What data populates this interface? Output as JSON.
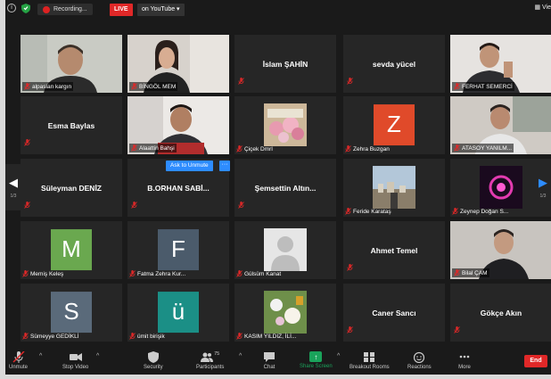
{
  "topbar": {
    "info_glyph": "i",
    "recording_label": "Recording...",
    "live_label": "LIVE",
    "youtube_label": "on YouTube ▾",
    "view_label": "▦ Vie"
  },
  "controls": {
    "ask_to_unmute": "Ask to Unmute",
    "more": "···"
  },
  "nav": {
    "prev_arrow": "◀",
    "next_arrow": "▶",
    "left_page": "1/3",
    "right_page": "1/3"
  },
  "tiles": [
    {
      "label": "alpaslan kargın"
    },
    {
      "label": "BİNGÖL MEM"
    },
    {
      "name": "İslam ŞAHİN"
    },
    {
      "name": "sevda yücel"
    },
    {
      "label": "FERHAT SEMERCİ"
    },
    {
      "name": "Esma Baylas"
    },
    {
      "label": "Alaattin Bahşi"
    },
    {
      "label": "Çiçek Dmrl"
    },
    {
      "label": "Zehra Buzgan",
      "initial": "Z"
    },
    {
      "label": "ATASOY YANILM..."
    },
    {
      "name": "Süleyman DENİZ"
    },
    {
      "name": "B.ORHAN SABİ..."
    },
    {
      "name": "Şemsettin Altın..."
    },
    {
      "label": "Feride Karataş"
    },
    {
      "label": "Zeynep Doğan S..."
    },
    {
      "label": "Memiş Keleş",
      "initial": "M"
    },
    {
      "label": "Fatma Zehra Kur...",
      "initial": "F"
    },
    {
      "label": "Gülsüm Kanat"
    },
    {
      "name": "Ahmet Temel"
    },
    {
      "label": "Bilal ÇAM"
    },
    {
      "label": "Sümeyye GEDİKLİ",
      "initial": "S"
    },
    {
      "label": "ümit birişik",
      "initial": "ü"
    },
    {
      "label": "KASIM YILDIZ, İLİ..."
    },
    {
      "name": "Caner Sancı"
    },
    {
      "name": "Gökçe Akın"
    }
  ],
  "toolbar": {
    "unmute": "Unmute",
    "stop_video": "Stop Video",
    "security": "Security",
    "participants": "Participants",
    "participants_count": "75",
    "chat": "Chat",
    "share_screen": "Share Screen",
    "breakout_rooms": "Breakout Rooms",
    "reactions": "Reactions",
    "more": "More",
    "end": "End",
    "caret": "^"
  },
  "colors": {
    "live": "#e02828",
    "active_speaker_border": "#c9d53a",
    "share_screen": "#1aa35b",
    "accent_blue": "#2d8cff",
    "avatar_M": "#6aa84f",
    "avatar_F": "#4b5b6b",
    "avatar_S": "#5a6a7a",
    "avatar_u": "#1b8f86",
    "avatar_Z": "#e04a2a"
  }
}
